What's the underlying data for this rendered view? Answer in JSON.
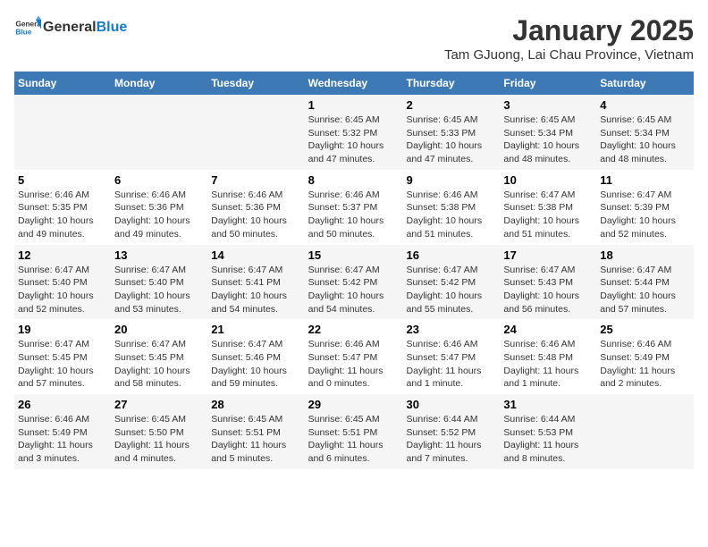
{
  "header": {
    "logo_general": "General",
    "logo_blue": "Blue",
    "month": "January 2025",
    "location": "Tam GJuong, Lai Chau Province, Vietnam"
  },
  "days_of_week": [
    "Sunday",
    "Monday",
    "Tuesday",
    "Wednesday",
    "Thursday",
    "Friday",
    "Saturday"
  ],
  "weeks": [
    [
      {
        "day": "",
        "info": ""
      },
      {
        "day": "",
        "info": ""
      },
      {
        "day": "",
        "info": ""
      },
      {
        "day": "1",
        "info": "Sunrise: 6:45 AM\nSunset: 5:32 PM\nDaylight: 10 hours and 47 minutes."
      },
      {
        "day": "2",
        "info": "Sunrise: 6:45 AM\nSunset: 5:33 PM\nDaylight: 10 hours and 47 minutes."
      },
      {
        "day": "3",
        "info": "Sunrise: 6:45 AM\nSunset: 5:34 PM\nDaylight: 10 hours and 48 minutes."
      },
      {
        "day": "4",
        "info": "Sunrise: 6:45 AM\nSunset: 5:34 PM\nDaylight: 10 hours and 48 minutes."
      }
    ],
    [
      {
        "day": "5",
        "info": "Sunrise: 6:46 AM\nSunset: 5:35 PM\nDaylight: 10 hours and 49 minutes."
      },
      {
        "day": "6",
        "info": "Sunrise: 6:46 AM\nSunset: 5:36 PM\nDaylight: 10 hours and 49 minutes."
      },
      {
        "day": "7",
        "info": "Sunrise: 6:46 AM\nSunset: 5:36 PM\nDaylight: 10 hours and 50 minutes."
      },
      {
        "day": "8",
        "info": "Sunrise: 6:46 AM\nSunset: 5:37 PM\nDaylight: 10 hours and 50 minutes."
      },
      {
        "day": "9",
        "info": "Sunrise: 6:46 AM\nSunset: 5:38 PM\nDaylight: 10 hours and 51 minutes."
      },
      {
        "day": "10",
        "info": "Sunrise: 6:47 AM\nSunset: 5:38 PM\nDaylight: 10 hours and 51 minutes."
      },
      {
        "day": "11",
        "info": "Sunrise: 6:47 AM\nSunset: 5:39 PM\nDaylight: 10 hours and 52 minutes."
      }
    ],
    [
      {
        "day": "12",
        "info": "Sunrise: 6:47 AM\nSunset: 5:40 PM\nDaylight: 10 hours and 52 minutes."
      },
      {
        "day": "13",
        "info": "Sunrise: 6:47 AM\nSunset: 5:40 PM\nDaylight: 10 hours and 53 minutes."
      },
      {
        "day": "14",
        "info": "Sunrise: 6:47 AM\nSunset: 5:41 PM\nDaylight: 10 hours and 54 minutes."
      },
      {
        "day": "15",
        "info": "Sunrise: 6:47 AM\nSunset: 5:42 PM\nDaylight: 10 hours and 54 minutes."
      },
      {
        "day": "16",
        "info": "Sunrise: 6:47 AM\nSunset: 5:42 PM\nDaylight: 10 hours and 55 minutes."
      },
      {
        "day": "17",
        "info": "Sunrise: 6:47 AM\nSunset: 5:43 PM\nDaylight: 10 hours and 56 minutes."
      },
      {
        "day": "18",
        "info": "Sunrise: 6:47 AM\nSunset: 5:44 PM\nDaylight: 10 hours and 57 minutes."
      }
    ],
    [
      {
        "day": "19",
        "info": "Sunrise: 6:47 AM\nSunset: 5:45 PM\nDaylight: 10 hours and 57 minutes."
      },
      {
        "day": "20",
        "info": "Sunrise: 6:47 AM\nSunset: 5:45 PM\nDaylight: 10 hours and 58 minutes."
      },
      {
        "day": "21",
        "info": "Sunrise: 6:47 AM\nSunset: 5:46 PM\nDaylight: 10 hours and 59 minutes."
      },
      {
        "day": "22",
        "info": "Sunrise: 6:46 AM\nSunset: 5:47 PM\nDaylight: 11 hours and 0 minutes."
      },
      {
        "day": "23",
        "info": "Sunrise: 6:46 AM\nSunset: 5:47 PM\nDaylight: 11 hours and 1 minute."
      },
      {
        "day": "24",
        "info": "Sunrise: 6:46 AM\nSunset: 5:48 PM\nDaylight: 11 hours and 1 minute."
      },
      {
        "day": "25",
        "info": "Sunrise: 6:46 AM\nSunset: 5:49 PM\nDaylight: 11 hours and 2 minutes."
      }
    ],
    [
      {
        "day": "26",
        "info": "Sunrise: 6:46 AM\nSunset: 5:49 PM\nDaylight: 11 hours and 3 minutes."
      },
      {
        "day": "27",
        "info": "Sunrise: 6:45 AM\nSunset: 5:50 PM\nDaylight: 11 hours and 4 minutes."
      },
      {
        "day": "28",
        "info": "Sunrise: 6:45 AM\nSunset: 5:51 PM\nDaylight: 11 hours and 5 minutes."
      },
      {
        "day": "29",
        "info": "Sunrise: 6:45 AM\nSunset: 5:51 PM\nDaylight: 11 hours and 6 minutes."
      },
      {
        "day": "30",
        "info": "Sunrise: 6:44 AM\nSunset: 5:52 PM\nDaylight: 11 hours and 7 minutes."
      },
      {
        "day": "31",
        "info": "Sunrise: 6:44 AM\nSunset: 5:53 PM\nDaylight: 11 hours and 8 minutes."
      },
      {
        "day": "",
        "info": ""
      }
    ]
  ]
}
